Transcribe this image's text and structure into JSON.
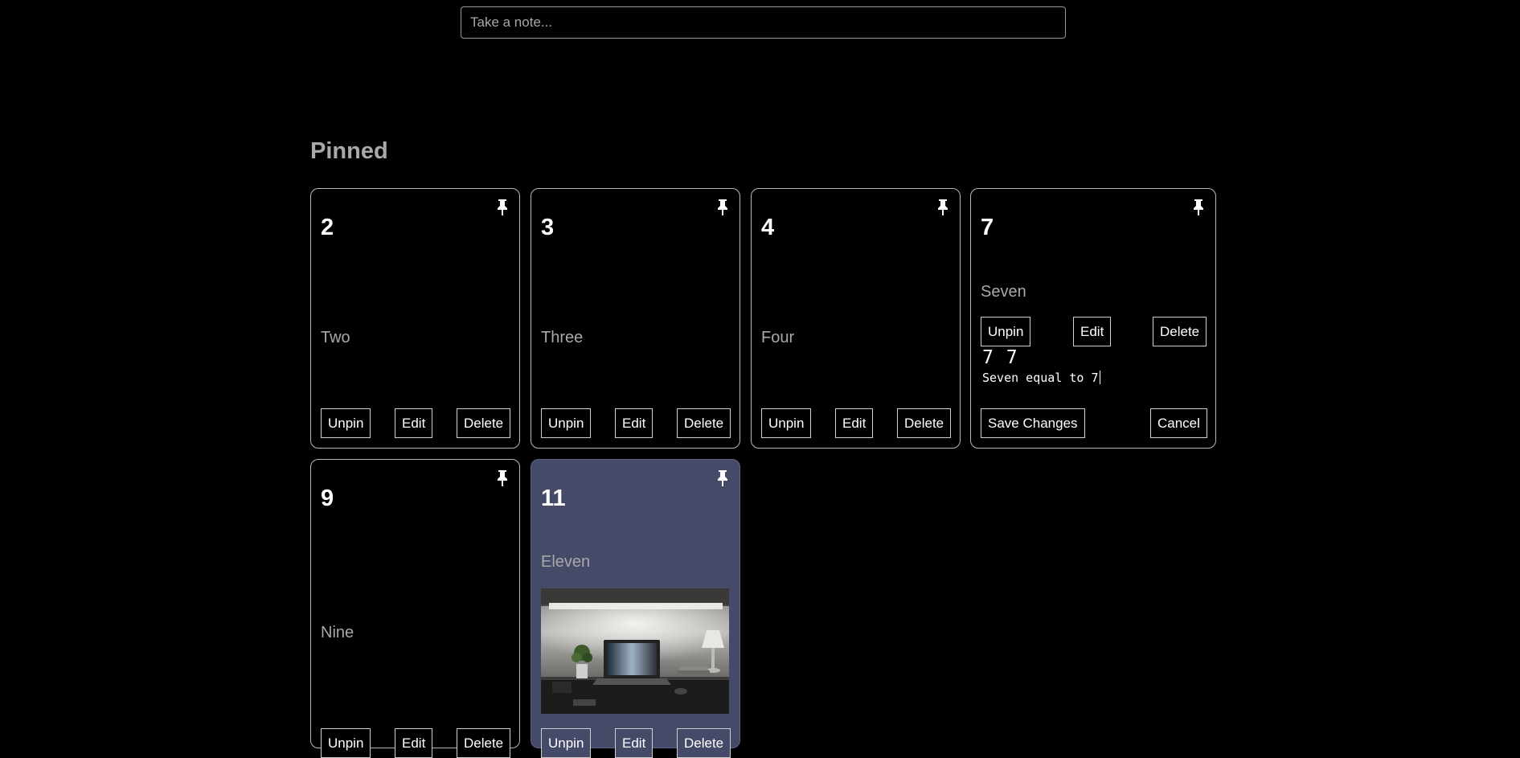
{
  "take_note": {
    "placeholder": "Take a note..."
  },
  "pinned": {
    "heading": "Pinned",
    "cards": [
      {
        "title": "2",
        "body": "Two",
        "unpin": "Unpin",
        "edit": "Edit",
        "delete": "Delete"
      },
      {
        "title": "3",
        "body": "Three",
        "unpin": "Unpin",
        "edit": "Edit",
        "delete": "Delete"
      },
      {
        "title": "4",
        "body": "Four",
        "unpin": "Unpin",
        "edit": "Edit",
        "delete": "Delete"
      },
      {
        "title": "7",
        "body": "Seven",
        "unpin": "Unpin",
        "edit": "Edit",
        "delete": "Delete",
        "edit_title_value": "7 7",
        "edit_text_value": "Seven equal to 7",
        "save": "Save Changes",
        "cancel": "Cancel"
      },
      {
        "title": "9",
        "body": "Nine",
        "unpin": "Unpin",
        "edit": "Edit",
        "delete": "Delete"
      },
      {
        "title": "11",
        "body": "Eleven",
        "unpin": "Unpin",
        "edit": "Edit",
        "delete": "Delete",
        "background": "#444a67",
        "image": "desk-laptop-photo"
      }
    ]
  },
  "icons": {
    "pin": "pin-icon"
  },
  "colors": {
    "background": "#000000",
    "muted_text": "#a9a9a9",
    "accent_card": "#444a67"
  }
}
